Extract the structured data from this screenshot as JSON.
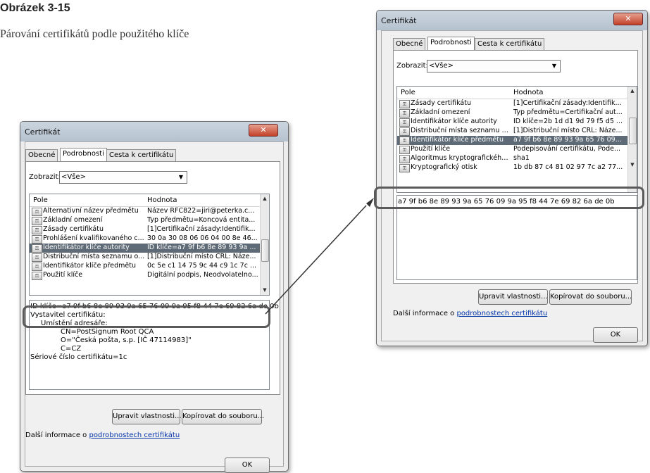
{
  "figure": {
    "title": "Obrázek 3-15",
    "caption": "Párování certifikátů podle použitého klíče"
  },
  "dialog_left": {
    "title": "Certifikát",
    "close_glyph": "✕",
    "tabs": [
      "Obecné",
      "Podrobnosti",
      "Cesta k certifikátu"
    ],
    "show_label": "Zobrazit:",
    "show_value": "<Vše>",
    "col_field": "Pole",
    "col_value": "Hodnota",
    "rows": [
      {
        "field": "Alternativní název předmětu",
        "value": "Název RFC822=jiri@peterka.c..."
      },
      {
        "field": "Základní omezení",
        "value": "Typ předmětu=Koncová entita..."
      },
      {
        "field": "Zásady certifikátu",
        "value": "[1]Certifikační zásady:Identifik..."
      },
      {
        "field": "Prohlášení kvalifikovaného c...",
        "value": "30 0a 30 08 06 06 04 00 8e 46..."
      },
      {
        "field": "Identifikátor klíče autority",
        "value": "ID klíče=a7 9f b6 8e 89 93 9a ..."
      },
      {
        "field": "Distribuční místa seznamu o...",
        "value": "[1]Distribuční místo CRL: Náze..."
      },
      {
        "field": "Identifikátor klíče předmětu",
        "value": "0c 5e c1 14 75 9c 44 c9 1c 7c ..."
      },
      {
        "field": "Použití klíče",
        "value": "Digitální podpis, Neodvolatelno..."
      }
    ],
    "detail_lines": [
      "ID klíče=a7 9f b6 8e 89 93 9a 65 76 09 9a 95 f8 44 7e 69 82 6a de 0b",
      "Vystavitel certifikátu:",
      "Umístění adresáře:",
      "CN=PostSignum Root QCA",
      "O=\"Česká pošta, s.p. [IČ 47114983]\"",
      "C=CZ",
      "Sériové číslo certifikátu=1c"
    ],
    "btn_edit": "Upravit vlastnosti...",
    "btn_copy": "Kopírovat do souboru...",
    "more_info_prefix": "Další informace o ",
    "more_info_link": "podrobnostech certifikátu",
    "btn_ok": "OK"
  },
  "dialog_right": {
    "title": "Certifikát",
    "close_glyph": "✕",
    "tabs": [
      "Obecné",
      "Podrobnosti",
      "Cesta k certifikátu"
    ],
    "show_label": "Zobrazit:",
    "show_value": "<Vše>",
    "col_field": "Pole",
    "col_value": "Hodnota",
    "rows": [
      {
        "field": "Zásady certifikátu",
        "value": "[1]Certifikační zásady:Identifik..."
      },
      {
        "field": "Základní omezení",
        "value": "Typ předmětu=Certifikační aut..."
      },
      {
        "field": "Identifikátor klíče autority",
        "value": "ID klíče=2b 1d d1 9d 79 f5 d5 ..."
      },
      {
        "field": "Distribuční místa seznamu o...",
        "value": "[1]Distribuční místo CRL: Náze..."
      },
      {
        "field": "Identifikátor klíče předmětu",
        "value": "a7 9f b6 8e 89 93 9a 65 76 09..."
      },
      {
        "field": "Použití klíče",
        "value": "Podepisování certifikátu, Pode..."
      },
      {
        "field": "Algoritmus kryptografického...",
        "value": "sha1"
      },
      {
        "field": "Kryptografický otisk",
        "value": "1b db 87 c4 81 02 97 7c a2 77..."
      }
    ],
    "detail_lines": [
      "a7 9f b6 8e 89 93 9a 65 76 09 9a 95 f8 44 7e 69 82 6a de 0b"
    ],
    "btn_edit": "Upravit vlastnosti...",
    "btn_copy": "Kopírovat do souboru...",
    "more_info_prefix": "Další informace o ",
    "more_info_link": "podrobnostech certifikátu",
    "btn_ok": "OK"
  }
}
